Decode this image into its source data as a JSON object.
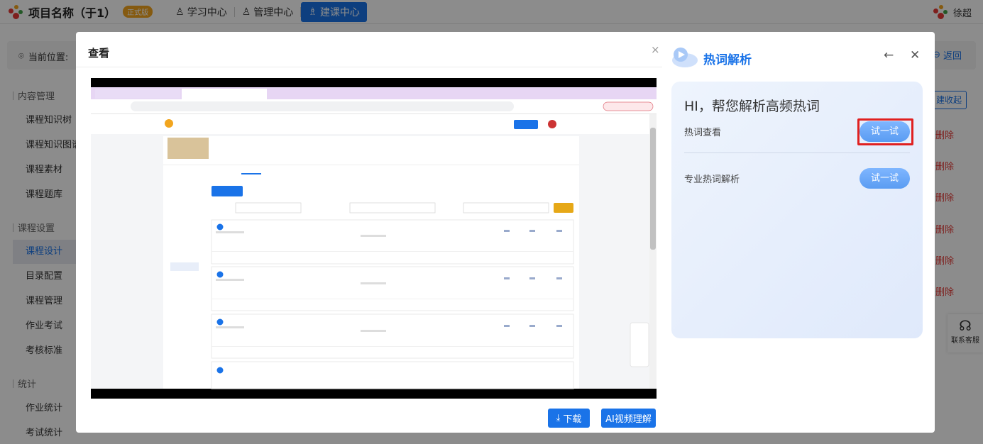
{
  "topbar": {
    "project_name": "项目名称（于1）",
    "badge": "正式版",
    "nav": [
      {
        "label": "学习中心",
        "icon": "user-icon"
      },
      {
        "label": "管理中心",
        "icon": "user-icon"
      },
      {
        "label": "建课中心",
        "icon": "users-icon",
        "active": true
      }
    ],
    "user_name": "徐超"
  },
  "breadcrumb": {
    "label": "当前位置:",
    "back": "返回"
  },
  "sidebar": {
    "sections": [
      {
        "title": "内容管理",
        "items": [
          "课程知识树",
          "课程知识图谱",
          "课程素材",
          "课程题库"
        ]
      },
      {
        "title": "课程设置",
        "items": [
          "课程设计",
          "目录配置",
          "课程管理",
          "作业考试",
          "考核标准"
        ]
      },
      {
        "title": "统计",
        "items": [
          "作业统计",
          "考试统计"
        ]
      }
    ],
    "selected": "课程设计"
  },
  "right_column": {
    "collapse": "建收起",
    "delete": "删除",
    "customer_service": "联系客服"
  },
  "modal": {
    "title": "查看",
    "close": "×",
    "download": "下载",
    "ai_video": "AI视频理解"
  },
  "panel": {
    "title": "热词解析",
    "greeting": "HI，帮您解析高频热词",
    "rows": [
      {
        "label": "热词查看",
        "button": "试一试"
      },
      {
        "label": "专业热词解析",
        "button": "试一试"
      }
    ]
  },
  "colors": {
    "accent": "#1a73e8",
    "danger": "#e53935",
    "highlight": "#e02020"
  }
}
